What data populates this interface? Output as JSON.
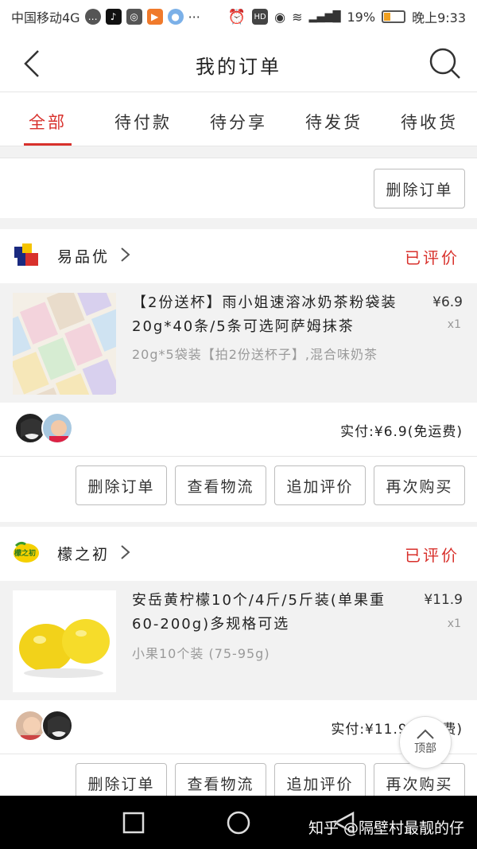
{
  "status_bar": {
    "carrier": "中国移动4G",
    "battery": "19%",
    "time": "晚上9:33"
  },
  "header": {
    "title": "我的订单"
  },
  "tabs": [
    {
      "label": "全部",
      "active": true
    },
    {
      "label": "待付款",
      "active": false
    },
    {
      "label": "待分享",
      "active": false
    },
    {
      "label": "待发货",
      "active": false
    },
    {
      "label": "待收货",
      "active": false
    }
  ],
  "prev_order": {
    "delete_label": "删除订单"
  },
  "orders": [
    {
      "shop_name": "易品优",
      "status": "已评价",
      "product_title": "【2份送杯】雨小姐速溶冰奶茶粉袋装20g*40条/5条可选阿萨姆抹茶",
      "spec": "20g*5袋装【拍2份送杯子】,混合味奶茶",
      "price": "¥6.9",
      "qty": "x1",
      "pay_text": "实付:¥6.9(免运费)",
      "actions": [
        "删除订单",
        "查看物流",
        "追加评价",
        "再次购买"
      ]
    },
    {
      "shop_name": "檬之初",
      "shop_logo_text": "檬之初",
      "status": "已评价",
      "product_title": "安岳黄柠檬10个/4斤/5斤装(单果重60-200g)多规格可选",
      "spec": "小果10个装 (75-95g)",
      "price": "¥11.9",
      "qty": "x1",
      "pay_text": "实付:¥11.9(免运费)",
      "actions": [
        "删除订单",
        "查看物流",
        "追加评价",
        "再次购买"
      ]
    }
  ],
  "float_button": {
    "label": "顶部"
  },
  "watermark": "知乎 @隔壁村最靓的仔",
  "colors": {
    "accent": "#d8312c",
    "background": "#f2f2f2"
  }
}
